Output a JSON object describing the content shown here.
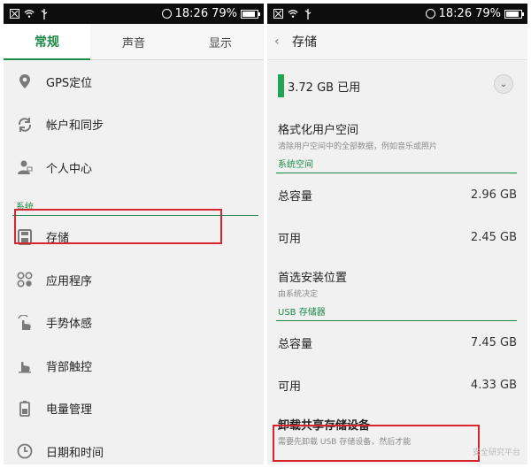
{
  "status": {
    "time": "18:26",
    "battery": "79%",
    "battery_level": 0.79
  },
  "left": {
    "tabs": [
      {
        "label": "常规",
        "active": true
      },
      {
        "label": "声音",
        "active": false
      },
      {
        "label": "显示",
        "active": false
      }
    ],
    "items_top": [
      {
        "label": "GPS定位",
        "icon": "location-pin-icon"
      },
      {
        "label": "帐户和同步",
        "icon": "sync-icon"
      },
      {
        "label": "个人中心",
        "icon": "person-icon"
      }
    ],
    "section_system": "系统",
    "items_system": [
      {
        "label": "存储",
        "icon": "storage-icon"
      },
      {
        "label": "应用程序",
        "icon": "apps-icon"
      },
      {
        "label": "手势体感",
        "icon": "gesture-icon"
      },
      {
        "label": "背部触控",
        "icon": "back-touch-icon"
      },
      {
        "label": "电量管理",
        "icon": "battery-icon"
      },
      {
        "label": "日期和时间",
        "icon": "clock-icon"
      }
    ]
  },
  "right": {
    "title": "存储",
    "used": "3.72 GB 已用",
    "format": {
      "title": "格式化用户空间",
      "subtitle": "清除用户空间中的全部数据，例如音乐或照片"
    },
    "section_system": "系统空间",
    "system_rows": [
      {
        "label": "总容量",
        "value": "2.96 GB"
      },
      {
        "label": "可用",
        "value": "2.45 GB"
      }
    ],
    "install": {
      "title": "首选安装位置",
      "subtitle": "由系统决定"
    },
    "section_usb": "USB 存储器",
    "usb_rows": [
      {
        "label": "总容量",
        "value": "7.45 GB"
      },
      {
        "label": "可用",
        "value": "4.33 GB"
      }
    ],
    "unmount": {
      "title": "卸载共享存储设备",
      "subtitle": "需要先卸载 USB 存储设备，然后才能"
    },
    "watermark": "安全研究平台"
  },
  "colors": {
    "accent": "#1f8a47",
    "highlight": "#d8242c",
    "usage_bar": "#22a352"
  }
}
